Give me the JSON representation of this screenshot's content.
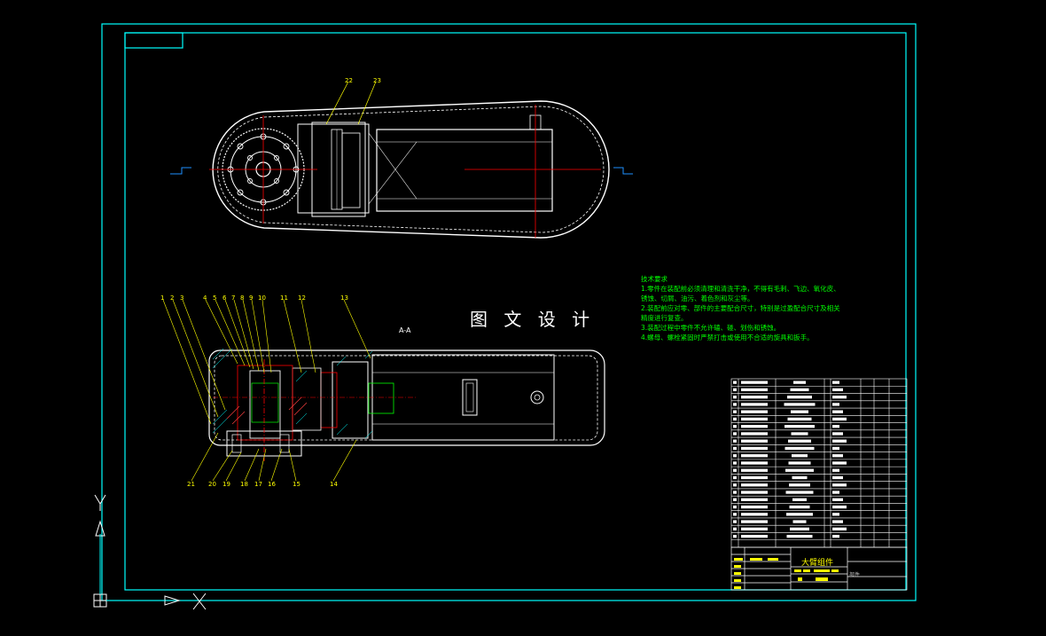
{
  "drawing": {
    "title_block_name": "大臂组件",
    "title_block_sub": "部件",
    "section_view_label": "A-A",
    "watermark": "图 文 设 计"
  },
  "technical_requirements": {
    "heading": "技术要求",
    "lines": [
      "1.零件在装配前必须清理和清洗干净，不得有毛刺、飞边、氧化皮、",
      "锈蚀、切屑、油污、着色剂和灰尘等。",
      "2.装配前应对零、部件的主要配合尺寸，特别是过盈配合尺寸及相关",
      "精度进行复查。",
      "3.装配过程中零件不允许磕、碰、划伤和锈蚀。",
      "4.螺母、螺栓紧固时严禁打击或使用不合适的旋具和扳手。"
    ]
  },
  "balloons_top": [
    "22",
    "23"
  ],
  "balloons_section_top": [
    "1",
    "2",
    "3",
    "4",
    "5",
    "6",
    "7",
    "8",
    "9",
    "10",
    "11",
    "12",
    "13"
  ],
  "balloons_section_bottom": [
    "21",
    "20",
    "19",
    "18",
    "17",
    "16",
    "15",
    "14"
  ],
  "colors": {
    "background": "#000000",
    "frame": "#00ffff",
    "geometry": "#ffffff",
    "centerline": "#ff0000",
    "leader": "#ffff00",
    "notes": "#00ff00",
    "dimension": "#00ff00",
    "hatch": "#00ffff"
  },
  "icons": [
    "ucs-origin-icon",
    "ucs-x-arrow-icon",
    "ucs-y-arrow-icon"
  ]
}
